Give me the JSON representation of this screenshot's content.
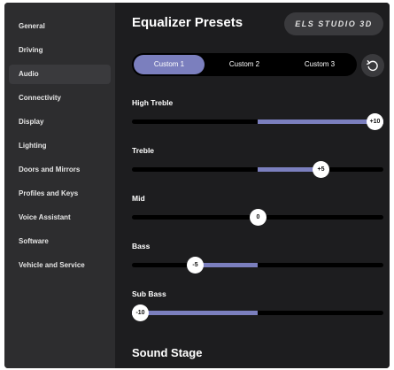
{
  "sidebar": {
    "items": [
      {
        "label": "General",
        "active": false
      },
      {
        "label": "Driving",
        "active": false
      },
      {
        "label": "Audio",
        "active": true
      },
      {
        "label": "Connectivity",
        "active": false
      },
      {
        "label": "Display",
        "active": false
      },
      {
        "label": "Lighting",
        "active": false
      },
      {
        "label": "Doors and Mirrors",
        "active": false
      },
      {
        "label": "Profiles and Keys",
        "active": false
      },
      {
        "label": "Voice Assistant",
        "active": false
      },
      {
        "label": "Software",
        "active": false
      },
      {
        "label": "Vehicle and Service",
        "active": false
      }
    ]
  },
  "main": {
    "title": "Equalizer Presets",
    "brand_badge": "ELS STUDIO 3D",
    "presets": [
      {
        "label": "Custom 1",
        "active": true
      },
      {
        "label": "Custom 2",
        "active": false
      },
      {
        "label": "Custom 3",
        "active": false
      }
    ],
    "reset_icon": "reset-icon",
    "bands": [
      {
        "label": "High Treble",
        "value": 10,
        "display": "+10"
      },
      {
        "label": "Treble",
        "value": 5,
        "display": "+5"
      },
      {
        "label": "Mid",
        "value": 0,
        "display": "0"
      },
      {
        "label": "Bass",
        "value": -5,
        "display": "-5"
      },
      {
        "label": "Sub Bass",
        "value": -10,
        "display": "-10"
      }
    ],
    "band_range": [
      -10,
      10
    ],
    "next_section_title": "Sound Stage"
  },
  "colors": {
    "accent": "#7b7fbe",
    "sidebar_bg": "#2d2d2f",
    "main_bg": "#1d1d1f",
    "track": "#000000"
  }
}
